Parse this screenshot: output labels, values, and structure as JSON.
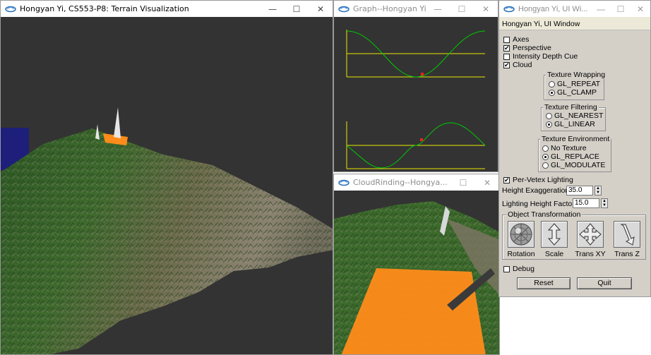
{
  "windows": {
    "terrain": {
      "title": "Hongyan Yi, CS553-P8: Terrain Visualization"
    },
    "graph": {
      "title": "Graph--Hongyan Yi"
    },
    "cloud": {
      "title": "CloudRinding--Hongya..."
    },
    "ui": {
      "title": "Hongyan Yi, UI Wi...",
      "heading": "Hongyan Yi, UI Window"
    }
  },
  "controls": {
    "minimize": "—",
    "maximize": "☐",
    "close": "✕"
  },
  "ui_panel": {
    "checks": [
      {
        "label": "Axes",
        "checked": false
      },
      {
        "label": "Perspective",
        "checked": true
      },
      {
        "label": "Intensity Depth Cue",
        "checked": false
      },
      {
        "label": "Cloud",
        "checked": true
      }
    ],
    "texture_wrapping": {
      "title": "Texture Wrapping",
      "options": [
        "GL_REPEAT",
        "GL_CLAMP"
      ],
      "selected": 1
    },
    "texture_filtering": {
      "title": "Texture Filtering",
      "options": [
        "GL_NEAREST",
        "GL_LINEAR"
      ],
      "selected": 1
    },
    "texture_environment": {
      "title": "Texture Environment",
      "options": [
        "No Texture",
        "GL_REPLACE",
        "GL_MODULATE"
      ],
      "selected": 1
    },
    "per_vertex": {
      "label": "Per-Vetex Lighting",
      "checked": true
    },
    "height_exaggeration": {
      "label": "Height Exaggeration",
      "value": "35.0"
    },
    "lighting_height": {
      "label": "Lighting Height Factor",
      "value": "15.0"
    },
    "object_transformation": {
      "title": "Object Transformation",
      "tools": [
        "Rotation",
        "Scale",
        "Trans XY",
        "Trans Z"
      ]
    },
    "debug": {
      "label": "Debug",
      "checked": false
    },
    "reset_label": "Reset",
    "quit_label": "Quit"
  },
  "icons": {
    "app": "opengl-app-icon",
    "check": "✔"
  },
  "colors": {
    "background": "#333333",
    "curve": "#00cc00",
    "axis": "#e8e800",
    "marker": "#ff2020",
    "cloud_plane": "#ff8c1a",
    "panel": "#d4d0c8"
  }
}
